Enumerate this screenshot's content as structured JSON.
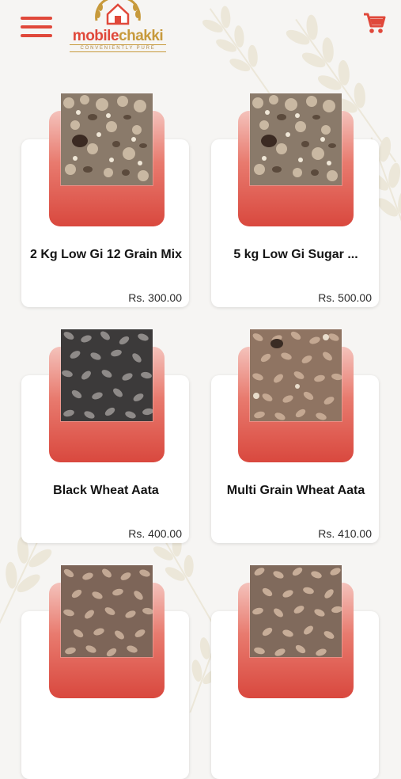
{
  "header": {
    "brand_a": "mobile",
    "brand_b": "chakki",
    "tagline": "CONVENIENTLY PURE"
  },
  "colors": {
    "accent": "#e0483a",
    "gold": "#c79a3c",
    "pack_top": "#f4c2bb",
    "pack_bottom": "#d9483e"
  },
  "products": [
    {
      "name": "2 Kg Low Gi 12 Grain Mix",
      "price": "Rs. 300.00",
      "image": "mixed-grains"
    },
    {
      "name": "5 kg Low Gi Sugar ...",
      "price": "Rs. 500.00",
      "image": "mixed-grains"
    },
    {
      "name": "Black Wheat Aata",
      "price": "Rs. 400.00",
      "image": "black-wheat"
    },
    {
      "name": "Multi Grain Wheat Aata",
      "price": "Rs. 410.00",
      "image": "multigrain-wheat"
    },
    {
      "name": "",
      "price": "",
      "image": "wheat"
    },
    {
      "name": "",
      "price": "",
      "image": "wheat"
    }
  ],
  "icons": [
    "hamburger-menu-icon",
    "cart-icon",
    "wheat-stalk-decoration"
  ]
}
